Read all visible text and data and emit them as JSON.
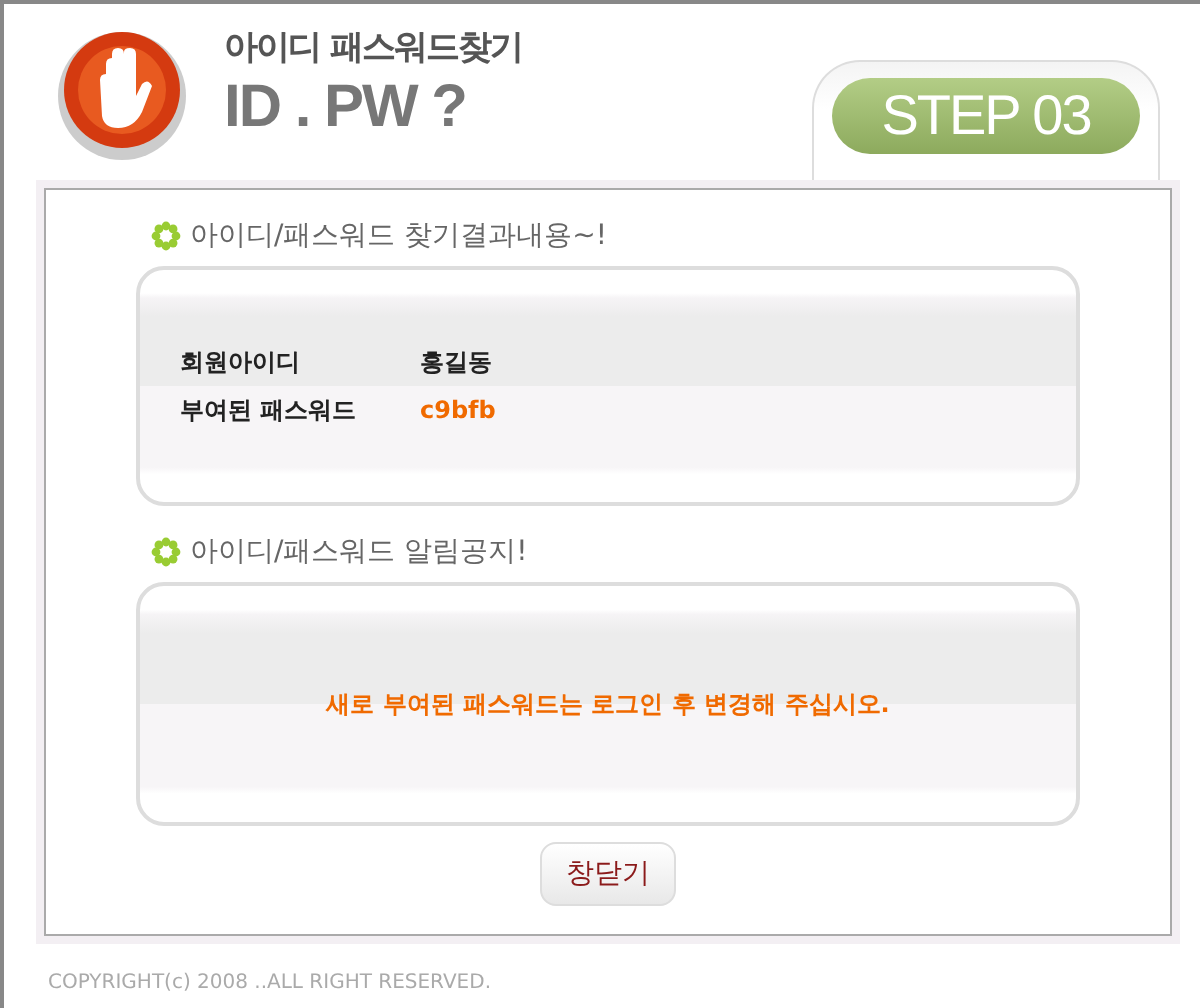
{
  "header": {
    "title": "아이디 패스워드찾기",
    "subtitle": "ID . PW ?",
    "step": "STEP 03"
  },
  "result_section": {
    "heading": "아이디/패스워드 찾기결과내용~!",
    "rows": [
      {
        "label": "회원아이디",
        "value": "홍길동",
        "kind": "plain"
      },
      {
        "label": "부여된 패스워드",
        "value": "c9bfb",
        "kind": "highlight"
      }
    ]
  },
  "notice_section": {
    "heading": "아이디/패스워드 알림공지!",
    "message": "새로 부여된 패스워드는 로그인 후 변경해 주십시오."
  },
  "buttons": [
    "창닫기"
  ],
  "footer": "COPYRIGHT(c) 2008 ..ALL RIGHT RESERVED."
}
